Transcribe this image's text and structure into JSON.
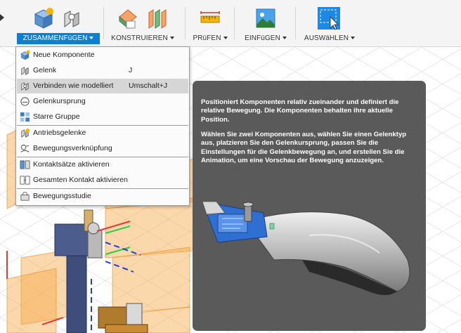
{
  "toolbar": {
    "groups": [
      {
        "label": "ZUSAMMENFüGEN",
        "active": true
      },
      {
        "label": "KONSTRUIEREN",
        "active": false
      },
      {
        "label": "PRüFEN",
        "active": false
      },
      {
        "label": "EINFüGEN",
        "active": false
      },
      {
        "label": "AUSWäHLEN",
        "active": false
      }
    ],
    "accent_color": "#0b7fd1"
  },
  "menu": {
    "items": [
      {
        "label": "Neue Komponente",
        "shortcut": "",
        "icon": "new-component-icon"
      },
      {
        "label": "Gelenk",
        "shortcut": "J",
        "icon": "joint-icon"
      },
      {
        "label": "Verbinden wie modelliert",
        "shortcut": "Umschalt+J",
        "icon": "as-built-joint-icon",
        "highlighted": true
      },
      {
        "label": "Gelenkursprung",
        "shortcut": "",
        "icon": "joint-origin-icon"
      },
      {
        "label": "Starre Gruppe",
        "shortcut": "",
        "icon": "rigid-group-icon"
      },
      {
        "label": "Antriebsgelenke",
        "shortcut": "",
        "icon": "drive-joints-icon"
      },
      {
        "label": "Bewegungsverknüpfung",
        "shortcut": "",
        "icon": "motion-link-icon"
      },
      {
        "label": "Kontaktsätze aktivieren",
        "shortcut": "",
        "icon": "enable-contact-sets-icon"
      },
      {
        "label": "Gesamten Kontakt aktivieren",
        "shortcut": "",
        "icon": "enable-all-contact-icon"
      },
      {
        "label": "Bewegungsstudie",
        "shortcut": "",
        "icon": "motion-study-icon"
      }
    ]
  },
  "tooltip": {
    "paragraph1": "Positioniert Komponenten relativ zueinander und definiert die relative Bewegung. Die Komponenten behalten ihre aktuelle Position.",
    "paragraph2": "Wählen Sie zwei Komponenten aus, wählen Sie einen Gelenktyp aus, platzieren Sie den Gelenkursprung, passen Sie die Einstellungen für die Gelenkbewegung an, und erstellen Sie die Animation, um eine Vorschau der Bewegung anzuzeigen."
  }
}
